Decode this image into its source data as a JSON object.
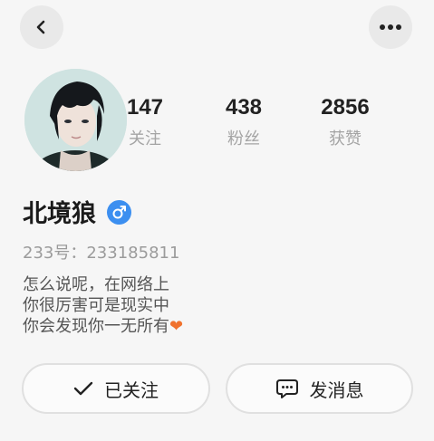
{
  "header": {
    "back_icon": "chevron-left-icon",
    "more_icon": "more-dots-icon"
  },
  "profile": {
    "name": "北境狼",
    "gender_icon": "male-icon",
    "uid_text": "233号：233185811",
    "bio_lines": [
      "怎么说呢，在网络上",
      "你很厉害可是现实中",
      "你会发现你一无所有"
    ],
    "bio_emoji": "heart-icon"
  },
  "stats": [
    {
      "value": "147",
      "label": "关注"
    },
    {
      "value": "438",
      "label": "粉丝"
    },
    {
      "value": "2856",
      "label": "获赞"
    }
  ],
  "actions": {
    "follow_label": "已关注",
    "message_label": "发消息"
  },
  "colors": {
    "gender": "#3c8ff0",
    "heart": "#f0722e",
    "background": "#f6f6f6"
  }
}
